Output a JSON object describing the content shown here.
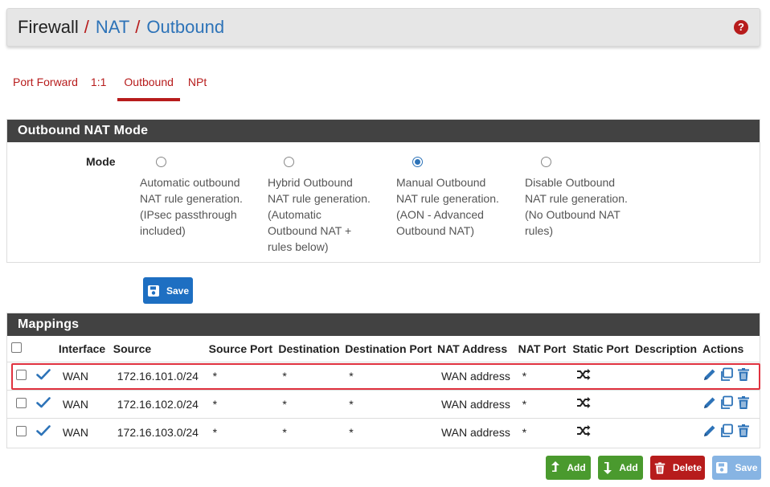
{
  "breadcrumb": {
    "root": "Firewall",
    "sep": "/",
    "nat": "NAT",
    "outbound": "Outbound"
  },
  "help_icon": "?",
  "tabs": [
    {
      "label": "Port Forward",
      "active": false
    },
    {
      "label": "1:1",
      "active": false
    },
    {
      "label": "Outbound",
      "active": true
    },
    {
      "label": "NPt",
      "active": false
    }
  ],
  "mode_panel": {
    "title": "Outbound NAT Mode",
    "label": "Mode",
    "options": [
      {
        "lines": [
          "Automatic outbound",
          "NAT rule generation.",
          "(IPsec passthrough",
          "included)"
        ],
        "checked": false
      },
      {
        "lines": [
          "Hybrid Outbound",
          "NAT rule generation.",
          "(Automatic",
          "Outbound NAT +",
          "rules below)"
        ],
        "checked": false
      },
      {
        "lines": [
          "Manual Outbound",
          "NAT rule generation.",
          "(AON - Advanced",
          "Outbound NAT)"
        ],
        "checked": true
      },
      {
        "lines": [
          "Disable Outbound",
          "NAT rule generation.",
          "(No Outbound NAT",
          "rules)"
        ],
        "checked": false
      }
    ],
    "save_label": "Save"
  },
  "mappings": {
    "title": "Mappings",
    "columns": [
      "Interface",
      "Source",
      "Source Port",
      "Destination",
      "Destination Port",
      "NAT Address",
      "NAT Port",
      "Static Port",
      "Description",
      "Actions"
    ],
    "rows": [
      {
        "interface": "WAN",
        "source": "172.16.101.0/24",
        "source_port": "*",
        "destination": "*",
        "destination_port": "*",
        "nat_address": "WAN address",
        "nat_port": "*",
        "description": "",
        "highlighted": true
      },
      {
        "interface": "WAN",
        "source": "172.16.102.0/24",
        "source_port": "*",
        "destination": "*",
        "destination_port": "*",
        "nat_address": "WAN address",
        "nat_port": "*",
        "description": "",
        "highlighted": false
      },
      {
        "interface": "WAN",
        "source": "172.16.103.0/24",
        "source_port": "*",
        "destination": "*",
        "destination_port": "*",
        "nat_address": "WAN address",
        "nat_port": "*",
        "description": "",
        "highlighted": false
      }
    ]
  },
  "bottom_buttons": {
    "add_top": "Add",
    "add_bottom": "Add",
    "delete": "Delete",
    "save": "Save"
  },
  "colors": {
    "accent_red": "#b71c1c",
    "link_blue": "#2d73b8",
    "panel_header": "#424242",
    "add_green": "#4a9a2e",
    "save_blue": "#1e6fc2",
    "highlight": "#e0323f"
  }
}
